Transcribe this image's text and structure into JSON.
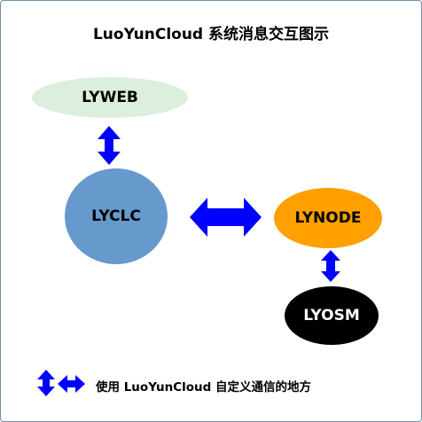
{
  "title": "LuoYunCloud 系统消息交互图示",
  "nodes": {
    "lyweb": {
      "label": "LYWEB",
      "fill": "#dceedd",
      "text_color": "#000000"
    },
    "lyclc": {
      "label": "LYCLC",
      "fill": "#6699cc",
      "text_color": "#000000"
    },
    "lynode": {
      "label": "LYNODE",
      "fill": "#ffa000",
      "text_color": "#000000"
    },
    "lyosm": {
      "label": "LYOSM",
      "fill": "#000000",
      "text_color": "#ffffff"
    }
  },
  "connections": [
    {
      "from": "LYWEB",
      "to": "LYCLC",
      "direction": "bidirectional-vertical"
    },
    {
      "from": "LYCLC",
      "to": "LYNODE",
      "direction": "bidirectional-horizontal"
    },
    {
      "from": "LYNODE",
      "to": "LYOSM",
      "direction": "bidirectional-vertical"
    }
  ],
  "legend": {
    "text": "使用 LuoYunCloud 自定义通信的地方"
  },
  "colors": {
    "arrow": "#0000ff",
    "border": "#6f8fb0",
    "background": "#ffffff"
  }
}
